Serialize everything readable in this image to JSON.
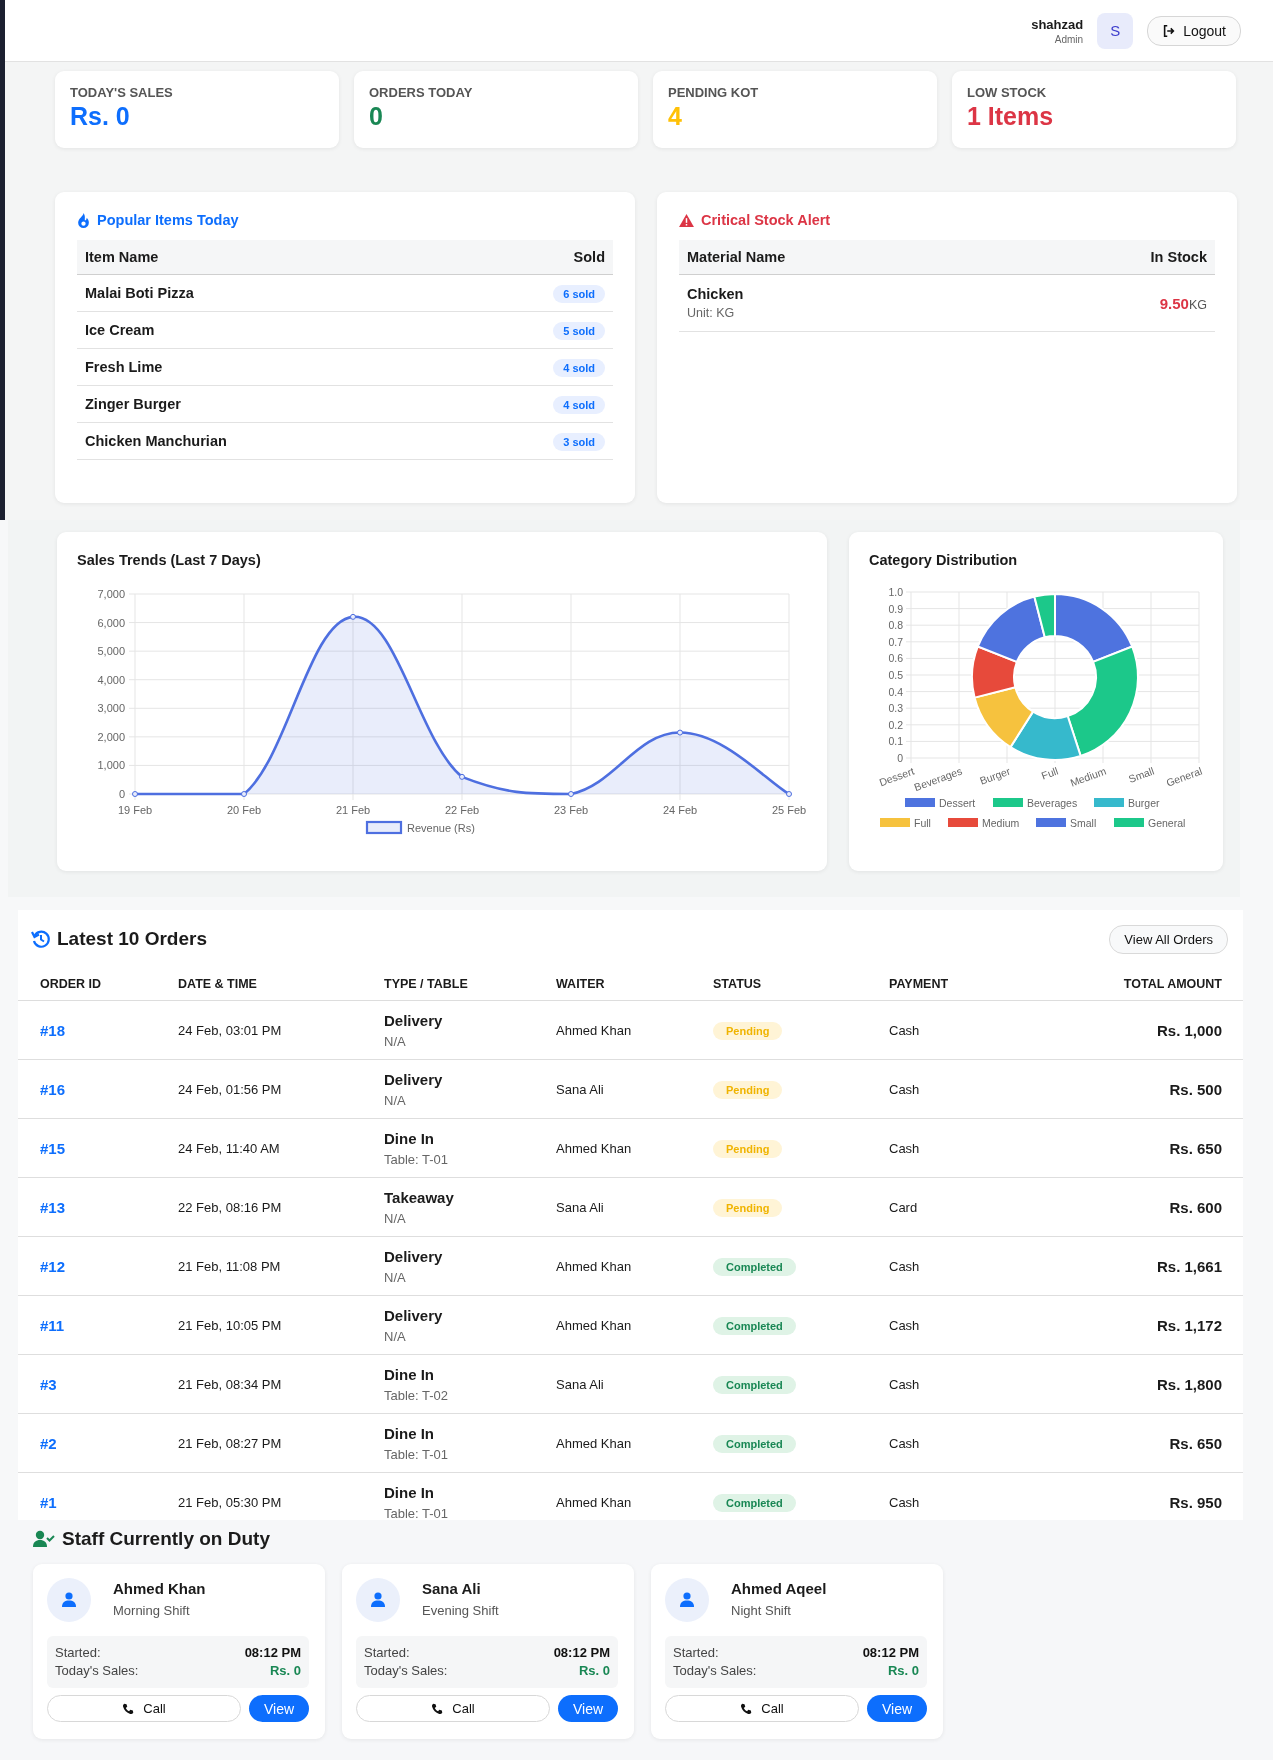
{
  "header": {
    "user_name": "shahzad",
    "user_role": "Admin",
    "avatar_letter": "S",
    "logout_label": "Logout"
  },
  "stats": [
    {
      "label": "TODAY'S SALES",
      "value": "Rs. 0",
      "color": "#0d6efd"
    },
    {
      "label": "ORDERS TODAY",
      "value": "0",
      "color": "#198754"
    },
    {
      "label": "PENDING KOT",
      "value": "4",
      "color": "#ffc107"
    },
    {
      "label": "LOW STOCK",
      "value": "1 Items",
      "color": "#dc3545"
    }
  ],
  "popular_items": {
    "title": "Popular Items Today",
    "columns": [
      "Item Name",
      "Sold"
    ],
    "rows": [
      {
        "name": "Malai Boti Pizza",
        "sold": "6 sold"
      },
      {
        "name": "Ice Cream",
        "sold": "5 sold"
      },
      {
        "name": "Fresh Lime",
        "sold": "4 sold"
      },
      {
        "name": "Zinger Burger",
        "sold": "4 sold"
      },
      {
        "name": "Chicken Manchurian",
        "sold": "3 sold"
      }
    ]
  },
  "stock_alert": {
    "title": "Critical Stock Alert",
    "columns": [
      "Material Name",
      "In Stock"
    ],
    "rows": [
      {
        "name": "Chicken",
        "unit_line": "Unit: KG",
        "quantity": "9.50",
        "unit": "KG"
      }
    ]
  },
  "sales_trends": {
    "title": "Sales Trends (Last 7 Days)",
    "chart_data": {
      "type": "area",
      "categories": [
        "19 Feb",
        "20 Feb",
        "21 Feb",
        "22 Feb",
        "23 Feb",
        "24 Feb",
        "25 Feb"
      ],
      "ylim": [
        0,
        7000
      ],
      "grid": true,
      "yticks": [
        {
          "value": 0,
          "label": "0"
        },
        {
          "value": 1000,
          "label": "1,000"
        },
        {
          "value": 2000,
          "label": "2,000"
        },
        {
          "value": 3000,
          "label": "3,000"
        },
        {
          "value": 4000,
          "label": "4,000"
        },
        {
          "value": 5000,
          "label": "5,000"
        },
        {
          "value": 6000,
          "label": "6,000"
        },
        {
          "value": 7000,
          "label": "7,000"
        }
      ],
      "series": [
        {
          "name": "Revenue (Rs)",
          "color": "#4e6fe0",
          "values": [
            0,
            0,
            6200,
            600,
            0,
            2150,
            0
          ]
        }
      ]
    }
  },
  "category_distribution": {
    "title": "Category Distribution",
    "chart_data": {
      "type": "donut",
      "categories": [
        "Dessert",
        "Beverages",
        "Burger",
        "Full",
        "Medium",
        "Small",
        "General"
      ],
      "grid": true,
      "values": [
        19,
        26,
        14,
        12,
        10,
        15,
        4
      ],
      "legend": true,
      "colors": [
        "#4e73df",
        "#1cc88a",
        "#36b9cc",
        "#f6c23e",
        "#e74a3b",
        "#4e73df",
        "#1cc88a"
      ]
    },
    "axis_y_labels": [
      "1.0",
      "0.9",
      "0.8",
      "0.7",
      "0.6",
      "0.5",
      "0.4",
      "0.3",
      "0.2",
      "0.1",
      "0"
    ],
    "axis_x_labels": [
      "Dessert",
      "Beverages",
      "Burger",
      "Full",
      "Medium",
      "Small",
      "General"
    ]
  },
  "orders": {
    "title": "Latest 10 Orders",
    "view_all_label": "View All Orders",
    "columns": [
      "ORDER ID",
      "DATE & TIME",
      "TYPE / TABLE",
      "WAITER",
      "STATUS",
      "PAYMENT",
      "TOTAL AMOUNT"
    ],
    "rows": [
      {
        "id": "#18",
        "datetime": "24 Feb, 03:01 PM",
        "type": "Delivery",
        "table": "N/A",
        "waiter": "Ahmed Khan",
        "status": "Pending",
        "kind": "pending",
        "payment": "Cash",
        "total": "Rs. 1,000"
      },
      {
        "id": "#16",
        "datetime": "24 Feb, 01:56 PM",
        "type": "Delivery",
        "table": "N/A",
        "waiter": "Sana Ali",
        "status": "Pending",
        "kind": "pending",
        "payment": "Cash",
        "total": "Rs. 500"
      },
      {
        "id": "#15",
        "datetime": "24 Feb, 11:40 AM",
        "type": "Dine In",
        "table": "Table: T-01",
        "waiter": "Ahmed Khan",
        "status": "Pending",
        "kind": "pending",
        "payment": "Cash",
        "total": "Rs. 650"
      },
      {
        "id": "#13",
        "datetime": "22 Feb, 08:16 PM",
        "type": "Takeaway",
        "table": "N/A",
        "waiter": "Sana Ali",
        "status": "Pending",
        "kind": "pending",
        "payment": "Card",
        "total": "Rs. 600"
      },
      {
        "id": "#12",
        "datetime": "21 Feb, 11:08 PM",
        "type": "Delivery",
        "table": "N/A",
        "waiter": "Ahmed Khan",
        "status": "Completed",
        "kind": "completed",
        "payment": "Cash",
        "total": "Rs. 1,661"
      },
      {
        "id": "#11",
        "datetime": "21 Feb, 10:05 PM",
        "type": "Delivery",
        "table": "N/A",
        "waiter": "Ahmed Khan",
        "status": "Completed",
        "kind": "completed",
        "payment": "Cash",
        "total": "Rs. 1,172"
      },
      {
        "id": "#3",
        "datetime": "21 Feb, 08:34 PM",
        "type": "Dine In",
        "table": "Table: T-02",
        "waiter": "Sana Ali",
        "status": "Completed",
        "kind": "completed",
        "payment": "Cash",
        "total": "Rs. 1,800"
      },
      {
        "id": "#2",
        "datetime": "21 Feb, 08:27 PM",
        "type": "Dine In",
        "table": "Table: T-01",
        "waiter": "Ahmed Khan",
        "status": "Completed",
        "kind": "completed",
        "payment": "Cash",
        "total": "Rs. 650"
      },
      {
        "id": "#1",
        "datetime": "21 Feb, 05:30 PM",
        "type": "Dine In",
        "table": "Table: T-01",
        "waiter": "Ahmed Khan",
        "status": "Completed",
        "kind": "completed",
        "payment": "Cash",
        "total": "Rs. 950"
      }
    ]
  },
  "staff": {
    "title": "Staff Currently on Duty",
    "members": [
      {
        "name": "Ahmed Khan",
        "shift": "Morning Shift",
        "started_label": "Started:",
        "started": "08:12 PM",
        "sales_label": "Today's Sales:",
        "sales": "Rs. 0",
        "call_label": "Call",
        "view_label": "View"
      },
      {
        "name": "Sana Ali",
        "shift": "Evening Shift",
        "started_label": "Started:",
        "started": "08:12 PM",
        "sales_label": "Today's Sales:",
        "sales": "Rs. 0",
        "call_label": "Call",
        "view_label": "View"
      },
      {
        "name": "Ahmed Aqeel",
        "shift": "Night Shift",
        "started_label": "Started:",
        "started": "08:12 PM",
        "sales_label": "Today's Sales:",
        "sales": "Rs. 0",
        "call_label": "Call",
        "view_label": "View"
      }
    ]
  }
}
